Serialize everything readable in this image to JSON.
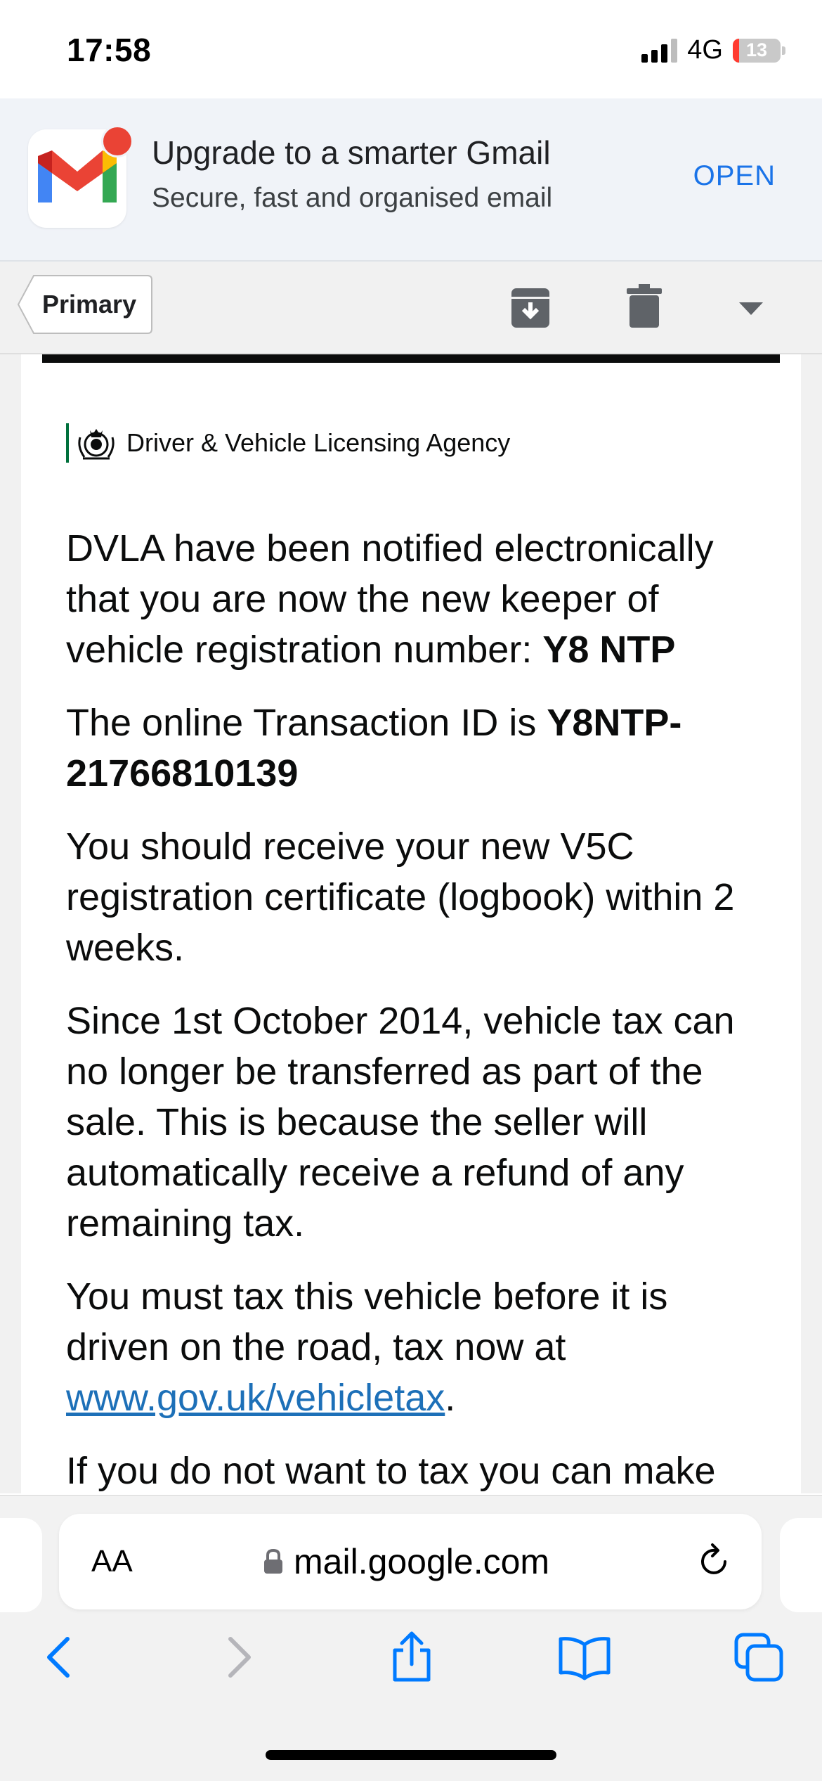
{
  "status_bar": {
    "time": "17:58",
    "network": "4G",
    "battery": "13"
  },
  "promo": {
    "title": "Upgrade to a smarter Gmail",
    "subtitle": "Secure, fast and organised email",
    "open_label": "OPEN"
  },
  "toolbar": {
    "back_label": "Primary"
  },
  "email": {
    "agency": "Driver & Vehicle Licensing Agency",
    "p1_text": "DVLA have been notified electronically that you are now the new keeper of vehicle registration number: ",
    "p1_reg": "Y8 NTP",
    "p2_text": "The online Transaction ID is ",
    "p2_id": "Y8NTP-21766810139",
    "p3": "You should receive your new V5C registration certificate (logbook) within 2 weeks.",
    "p4": "Since 1st October 2014, vehicle tax can no longer be transferred as part of the sale. This is because the seller will automatically receive a refund of any remaining tax.",
    "p5_text": "You must tax this vehicle before it is driven on the road, tax now at ",
    "p5_link": "www.gov.uk/vehicletax",
    "p5_end": ".",
    "p6": "If you do not want to tax you can make"
  },
  "browser": {
    "aa_label": "AA",
    "url": "mail.google.com"
  },
  "colors": {
    "link": "#1d70b8",
    "accent_blue": "#1a73e8",
    "gmail_red": "#ea4335",
    "gov_green": "#00703c"
  }
}
